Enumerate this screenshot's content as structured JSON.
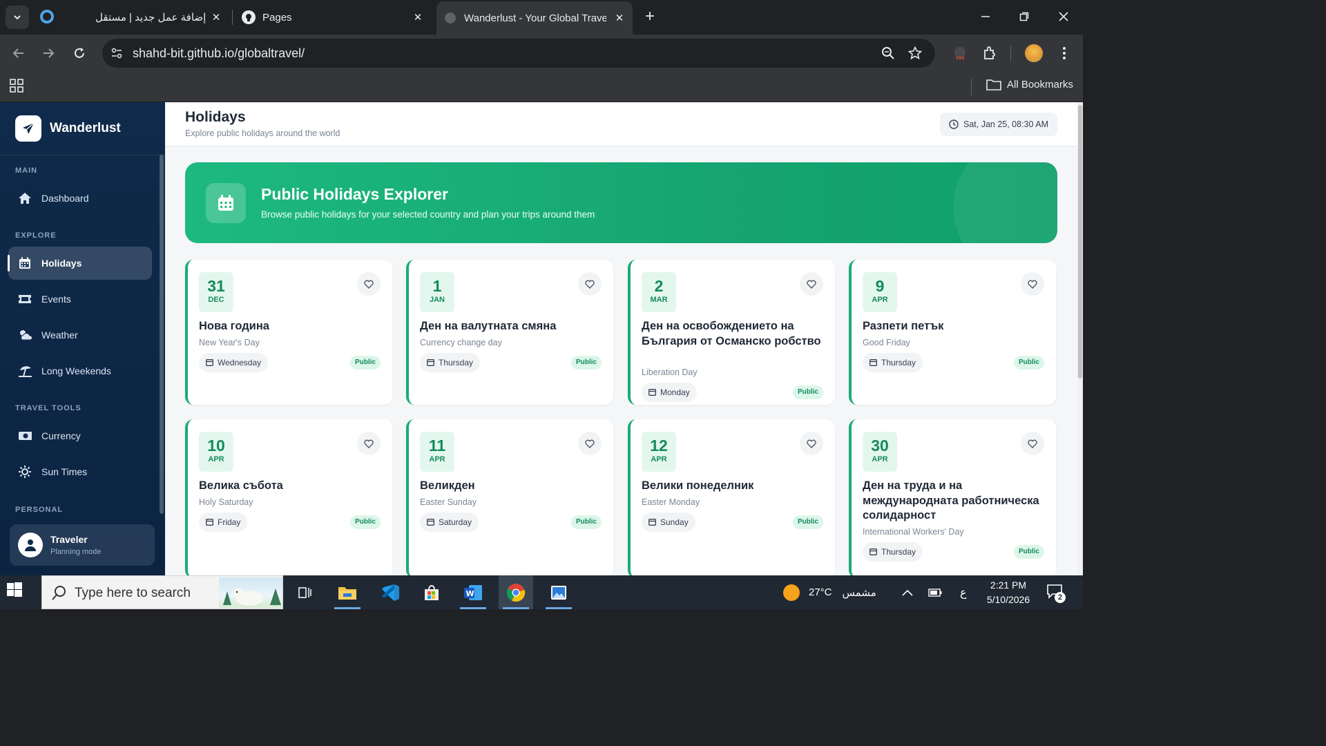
{
  "browser": {
    "tabs": [
      {
        "title": "إضافة عمل جديد | مستقل",
        "active": false
      },
      {
        "title": "Pages",
        "active": false
      },
      {
        "title": "Wanderlust - Your Global Travel",
        "active": true
      }
    ],
    "url": "shahd-bit.github.io/globaltravel/",
    "bookmarks_label": "All Bookmarks"
  },
  "sidebar": {
    "brand": "Wanderlust",
    "sections": {
      "main": "MAIN",
      "explore": "EXPLORE",
      "tools": "TRAVEL TOOLS",
      "personal": "PERSONAL"
    },
    "items": [
      {
        "label": "Dashboard",
        "icon": "home-icon"
      },
      {
        "label": "Holidays",
        "icon": "calendar-icon",
        "active": true
      },
      {
        "label": "Events",
        "icon": "ticket-icon"
      },
      {
        "label": "Weather",
        "icon": "cloud-sun-icon"
      },
      {
        "label": "Long Weekends",
        "icon": "umbrella-beach-icon"
      },
      {
        "label": "Currency",
        "icon": "money-icon"
      },
      {
        "label": "Sun Times",
        "icon": "sun-icon"
      }
    ],
    "user": {
      "name": "Traveler",
      "mode": "Planning mode"
    }
  },
  "header": {
    "title": "Holidays",
    "subtitle": "Explore public holidays around the world",
    "datetime": "Sat, Jan 25, 08:30 AM"
  },
  "hero": {
    "title": "Public Holidays Explorer",
    "subtitle": "Browse public holidays for your selected country and plan your trips around them"
  },
  "holidays": [
    {
      "day": "31",
      "month": "DEC",
      "local": "Нова година",
      "name": "New Year's Day",
      "weekday": "Wednesday",
      "type": "Public"
    },
    {
      "day": "1",
      "month": "JAN",
      "local": "Ден на валутната смяна",
      "name": "Currency change day",
      "weekday": "Thursday",
      "type": "Public"
    },
    {
      "day": "2",
      "month": "MAR",
      "local": "Ден на освобождението на България от Османско робство",
      "name": "Liberation Day",
      "weekday": "Monday",
      "type": "Public"
    },
    {
      "day": "9",
      "month": "APR",
      "local": "Разпети петък",
      "name": "Good Friday",
      "weekday": "Thursday",
      "type": "Public"
    },
    {
      "day": "10",
      "month": "APR",
      "local": "Велика събота",
      "name": "Holy Saturday",
      "weekday": "Friday",
      "type": "Public"
    },
    {
      "day": "11",
      "month": "APR",
      "local": "Великден",
      "name": "Easter Sunday",
      "weekday": "Saturday",
      "type": "Public"
    },
    {
      "day": "12",
      "month": "APR",
      "local": "Велики понеделник",
      "name": "Easter Monday",
      "weekday": "Sunday",
      "type": "Public"
    },
    {
      "day": "30",
      "month": "APR",
      "local": "Ден на труда и на международната работническа солидарност",
      "name": "International Workers' Day",
      "weekday": "Thursday",
      "type": "Public"
    }
  ],
  "taskbar": {
    "search_placeholder": "Type here to search",
    "temperature": "27°C",
    "weather_label": "مشمس",
    "lang": "ع",
    "time": "2:21 PM",
    "date": "5/10/2026",
    "notifications": "2"
  },
  "colors": {
    "accent": "#1aab76",
    "sidebar": "#0f2a4a",
    "badge_bg": "#e4f7ee"
  }
}
